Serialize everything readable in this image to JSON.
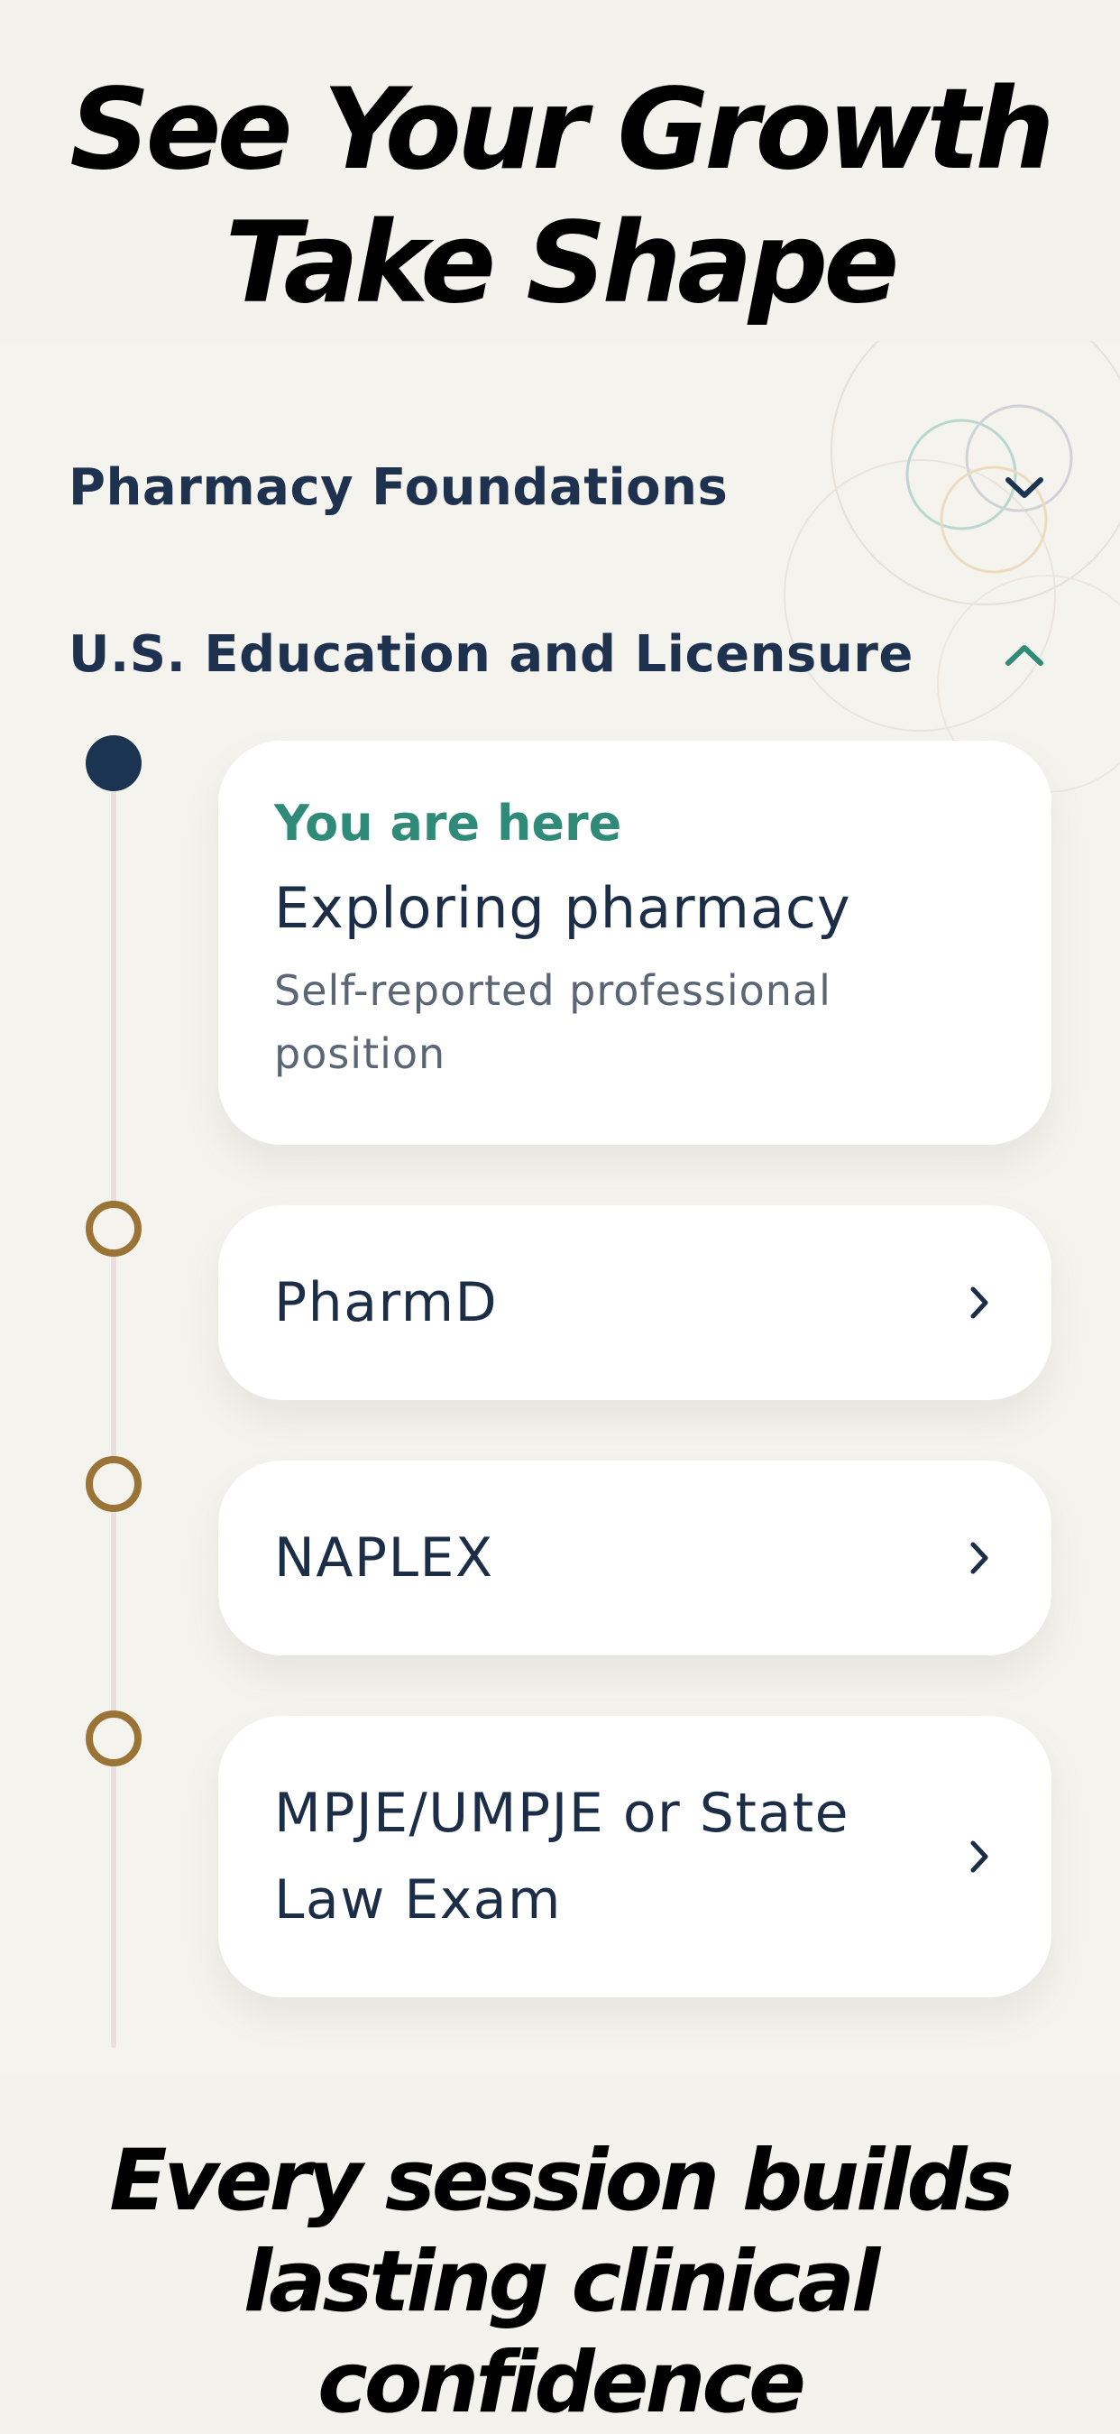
{
  "promo": {
    "headline_line1": "See Your Growth",
    "headline_line2": "Take Shape",
    "footer_line1": "Every session builds",
    "footer_line2": "lasting clinical confidence"
  },
  "sections": [
    {
      "title": "Pharmacy Foundations",
      "expanded": false,
      "chevron_icon": "chevron-down-icon"
    },
    {
      "title": "U.S. Education and Licensure",
      "expanded": true,
      "chevron_icon": "chevron-up-icon"
    }
  ],
  "current_step": {
    "eyebrow": "You are here",
    "title": "Exploring pharmacy",
    "subtitle_line1": "Self-reported professional",
    "subtitle_line2": "position"
  },
  "steps": [
    {
      "label": "PharmD",
      "icon": "chevron-right-icon"
    },
    {
      "label": "NAPLEX",
      "icon": "chevron-right-icon"
    },
    {
      "label_line1": "MPJE/UMPJE or State",
      "label_line2": "Law Exam",
      "icon": "chevron-right-icon"
    }
  ],
  "colors": {
    "navy": "#1b3452",
    "teal": "#2f8a78",
    "gold": "#9a7336",
    "background": "#f4f2ed"
  }
}
